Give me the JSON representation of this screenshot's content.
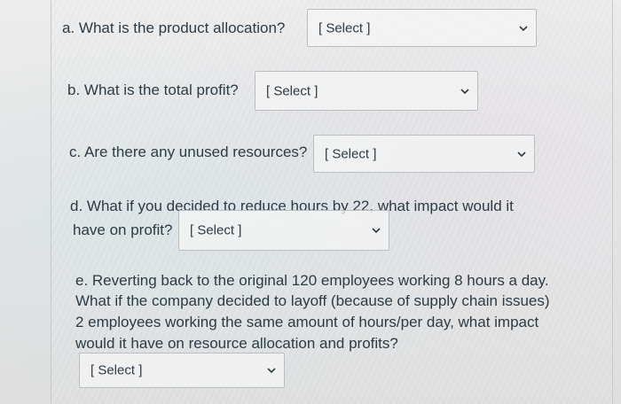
{
  "questions": {
    "a": {
      "text": "a. What is the product allocation?",
      "selected": "[ Select ]"
    },
    "b": {
      "text": "b. What is the total profit?",
      "selected": "[ Select ]"
    },
    "c": {
      "text": "c. Are there any unused resources?",
      "selected": "[ Select ]"
    },
    "d": {
      "line1": "d. What if you decided to reduce hours by 22, what impact would it",
      "line2": "have on profit?",
      "selected": "[ Select ]"
    },
    "e": {
      "line1": "e. Reverting back to the original 120 employees working 8 hours a day.",
      "line2": "What if the company decided to layoff (because of supply chain issues)",
      "line3": "2 employees working the same amount of hours/per day, what impact",
      "line4": "would it have on resource allocation and profits?",
      "selected": "[ Select ]"
    }
  },
  "icons": {
    "dropdown": "chevron-down-icon"
  }
}
